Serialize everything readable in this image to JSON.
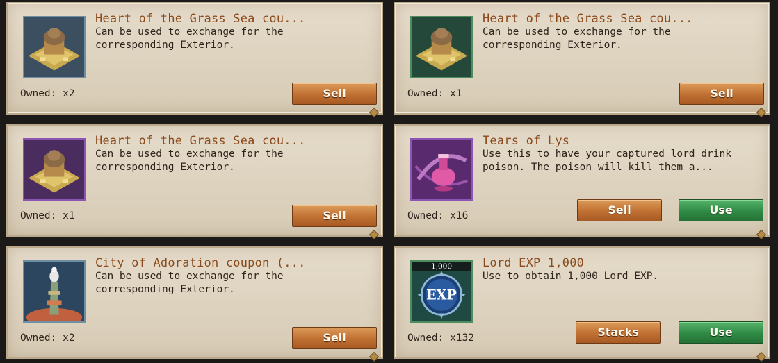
{
  "items": [
    {
      "title": "Heart of the Grass Sea cou...",
      "description": "Can be used to exchange for the\ncorresponding Exterior.",
      "owned": "Owned: x2",
      "sell_label": "Sell",
      "icon": "grass-sea-building-icon",
      "frame_color": "#6f8fa5"
    },
    {
      "title": "Heart of the Grass Sea cou...",
      "description": "Can be used to exchange for the\ncorresponding Exterior.",
      "owned": "Owned: x1",
      "sell_label": "Sell",
      "icon": "grass-sea-building-icon",
      "frame_color": "#4e8c5d"
    },
    {
      "title": "Heart of the Grass Sea cou...",
      "description": "Can be used to exchange for the\ncorresponding Exterior.",
      "owned": "Owned: x1",
      "sell_label": "Sell",
      "icon": "grass-sea-building-icon",
      "frame_color": "#8c55b3"
    },
    {
      "title": "Tears of Lys",
      "description": "Use this to have your captured lord drink\npoison. The poison will kill them a...",
      "owned": "Owned: x16",
      "sell_label": "Sell",
      "use_label": "Use",
      "icon": "poison-vial-icon",
      "frame_color": "#8c55b3"
    },
    {
      "title": "City of Adoration coupon (...",
      "description": "Can be used to exchange for the\ncorresponding Exterior.",
      "owned": "Owned: x2",
      "sell_label": "Sell",
      "icon": "city-of-adoration-tower-icon",
      "frame_color": "#6f8fa5"
    },
    {
      "title": "Lord EXP 1,000",
      "description": "Use to obtain 1,000 Lord EXP.",
      "owned": "Owned: x132",
      "stacks_label": "Stacks",
      "use_label": "Use",
      "icon": "exp-badge-icon",
      "icon_caption": "1,000",
      "icon_text": "EXP",
      "frame_color": "#4e8c5d"
    }
  ],
  "colors": {
    "title": "#8a4a1c",
    "sell_button": "#c07032",
    "use_button": "#2f8a45"
  }
}
